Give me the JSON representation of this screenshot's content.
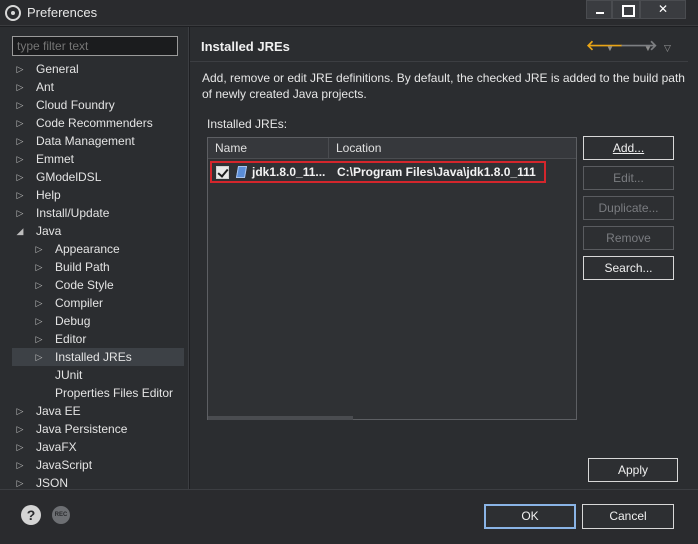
{
  "window": {
    "title": "Preferences"
  },
  "filter": {
    "placeholder": "type filter text"
  },
  "tree": [
    {
      "label": "General",
      "level": 0,
      "arrow": "▷"
    },
    {
      "label": "Ant",
      "level": 0,
      "arrow": "▷"
    },
    {
      "label": "Cloud Foundry",
      "level": 0,
      "arrow": "▷"
    },
    {
      "label": "Code Recommenders",
      "level": 0,
      "arrow": "▷"
    },
    {
      "label": "Data Management",
      "level": 0,
      "arrow": "▷"
    },
    {
      "label": "Emmet",
      "level": 0,
      "arrow": "▷"
    },
    {
      "label": "GModelDSL",
      "level": 0,
      "arrow": "▷"
    },
    {
      "label": "Help",
      "level": 0,
      "arrow": "▷"
    },
    {
      "label": "Install/Update",
      "level": 0,
      "arrow": "▷"
    },
    {
      "label": "Java",
      "level": 0,
      "arrow": "◢"
    },
    {
      "label": "Appearance",
      "level": 1,
      "arrow": "▷"
    },
    {
      "label": "Build Path",
      "level": 1,
      "arrow": "▷"
    },
    {
      "label": "Code Style",
      "level": 1,
      "arrow": "▷"
    },
    {
      "label": "Compiler",
      "level": 1,
      "arrow": "▷"
    },
    {
      "label": "Debug",
      "level": 1,
      "arrow": "▷"
    },
    {
      "label": "Editor",
      "level": 1,
      "arrow": "▷"
    },
    {
      "label": "Installed JREs",
      "level": 1,
      "arrow": "▷"
    },
    {
      "label": "JUnit",
      "level": 1,
      "arrow": ""
    },
    {
      "label": "Properties Files Editor",
      "level": 1,
      "arrow": ""
    },
    {
      "label": "Java EE",
      "level": 0,
      "arrow": "▷"
    },
    {
      "label": "Java Persistence",
      "level": 0,
      "arrow": "▷"
    },
    {
      "label": "JavaFX",
      "level": 0,
      "arrow": "▷"
    },
    {
      "label": "JavaScript",
      "level": 0,
      "arrow": "▷"
    },
    {
      "label": "JSON",
      "level": 0,
      "arrow": "▷"
    }
  ],
  "selected_tree_item": "Installed JREs",
  "page": {
    "title": "Installed JREs",
    "description": "Add, remove or edit JRE definitions. By default, the checked JRE is added to the build path of newly created Java projects.",
    "table_label": "Installed JREs:",
    "columns": {
      "name": "Name",
      "location": "Location"
    },
    "rows": [
      {
        "checked": true,
        "name": "jdk1.8.0_11...",
        "location": "C:\\Program Files\\Java\\jdk1.8.0_111"
      }
    ]
  },
  "nav": {
    "back_icon": "arrow-left-icon",
    "forward_icon": "arrow-right-icon",
    "menu_icon": "view-menu-icon"
  },
  "buttons": {
    "add": "Add...",
    "edit": "Edit...",
    "duplicate": "Duplicate...",
    "remove": "Remove",
    "search": "Search...",
    "apply": "Apply",
    "ok": "OK",
    "cancel": "Cancel"
  },
  "colors": {
    "background": "#2b2d30",
    "highlight_border": "#d4262c",
    "back_arrow": "#e8a417",
    "ok_focus": "#8ab4e6"
  }
}
